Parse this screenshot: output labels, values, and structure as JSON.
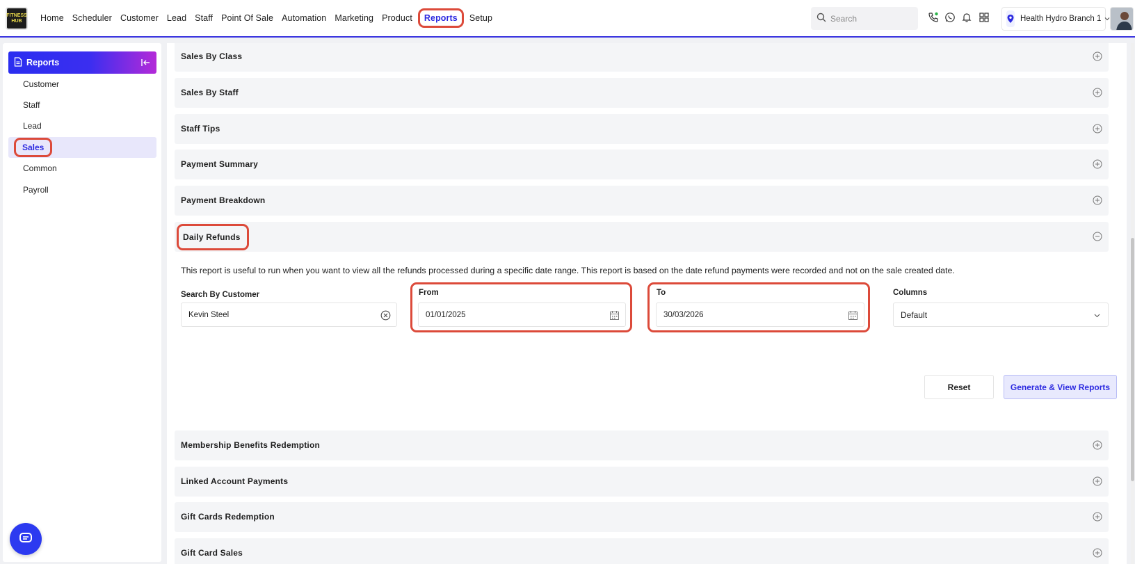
{
  "app": {
    "logo_text": "FITNESS HUB"
  },
  "nav": {
    "items": [
      {
        "label": "Home"
      },
      {
        "label": "Scheduler"
      },
      {
        "label": "Customer"
      },
      {
        "label": "Lead"
      },
      {
        "label": "Staff"
      },
      {
        "label": "Point Of Sale"
      },
      {
        "label": "Automation"
      },
      {
        "label": "Marketing"
      },
      {
        "label": "Product"
      },
      {
        "label": "Reports",
        "active": true
      },
      {
        "label": "Setup"
      }
    ],
    "search_placeholder": "Search",
    "branch_label": "Health Hydro Branch 1",
    "icons": [
      "search-icon",
      "phone-icon",
      "whatsapp-icon",
      "bell-icon",
      "grid-icon",
      "location-pin-icon",
      "chevron-down-icon"
    ]
  },
  "sidebar": {
    "title": "Reports",
    "items": [
      {
        "label": "Customer"
      },
      {
        "label": "Staff"
      },
      {
        "label": "Lead"
      },
      {
        "label": "Sales",
        "selected": true
      },
      {
        "label": "Common"
      },
      {
        "label": "Payroll"
      }
    ]
  },
  "main": {
    "reports": [
      {
        "title": "Sales By Class",
        "expanded": false
      },
      {
        "title": "Sales By Staff",
        "expanded": false
      },
      {
        "title": "Staff Tips",
        "expanded": false
      },
      {
        "title": "Payment Summary",
        "expanded": false
      },
      {
        "title": "Payment Breakdown",
        "expanded": false
      },
      {
        "title": "Daily Refunds",
        "expanded": true
      },
      {
        "title": "Membership Benefits Redemption",
        "expanded": false
      },
      {
        "title": "Linked Account Payments",
        "expanded": false
      },
      {
        "title": "Gift Cards Redemption",
        "expanded": false
      },
      {
        "title": "Gift Card Sales",
        "expanded": false
      }
    ],
    "daily_refunds": {
      "description": "This report is useful to run when you want to view all the refunds processed during a specific date range. This report is based on the date refund payments were recorded and not on the sale created date.",
      "customer_label": "Search By Customer",
      "customer_value": "Kevin Steel",
      "from_label": "From",
      "from_value": "01/01/2025",
      "to_label": "To",
      "to_value": "30/03/2026",
      "columns_label": "Columns",
      "columns_value": "Default",
      "reset_label": "Reset",
      "generate_label": "Generate & View Reports"
    }
  },
  "colors": {
    "accent": "#2c2ae0",
    "highlight": "#dc4a3a",
    "header_gradient_start": "#2a2df0",
    "header_gradient_end": "#b42ad8"
  }
}
